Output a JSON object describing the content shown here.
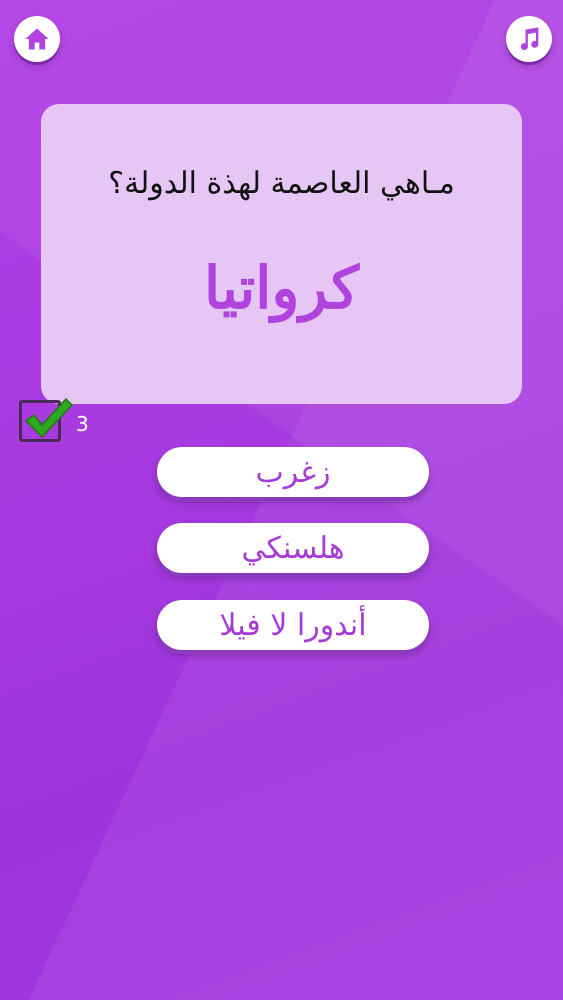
{
  "header": {
    "home_icon": "home-icon",
    "music_icon": "music-icon"
  },
  "question": {
    "prompt": "مـاهي العاصمة لهذة الدولة؟",
    "country": "كرواتيا"
  },
  "score": {
    "correct_count": "3",
    "icon": "checkmark-icon"
  },
  "answers": [
    {
      "label": "زغرب"
    },
    {
      "label": "هلسنكي"
    },
    {
      "label": "أندورا لا فيلا"
    }
  ],
  "colors": {
    "background": "#a83ae0",
    "card": "#e6c6f5",
    "accent": "#b043dd",
    "check": "#2fa71f"
  }
}
